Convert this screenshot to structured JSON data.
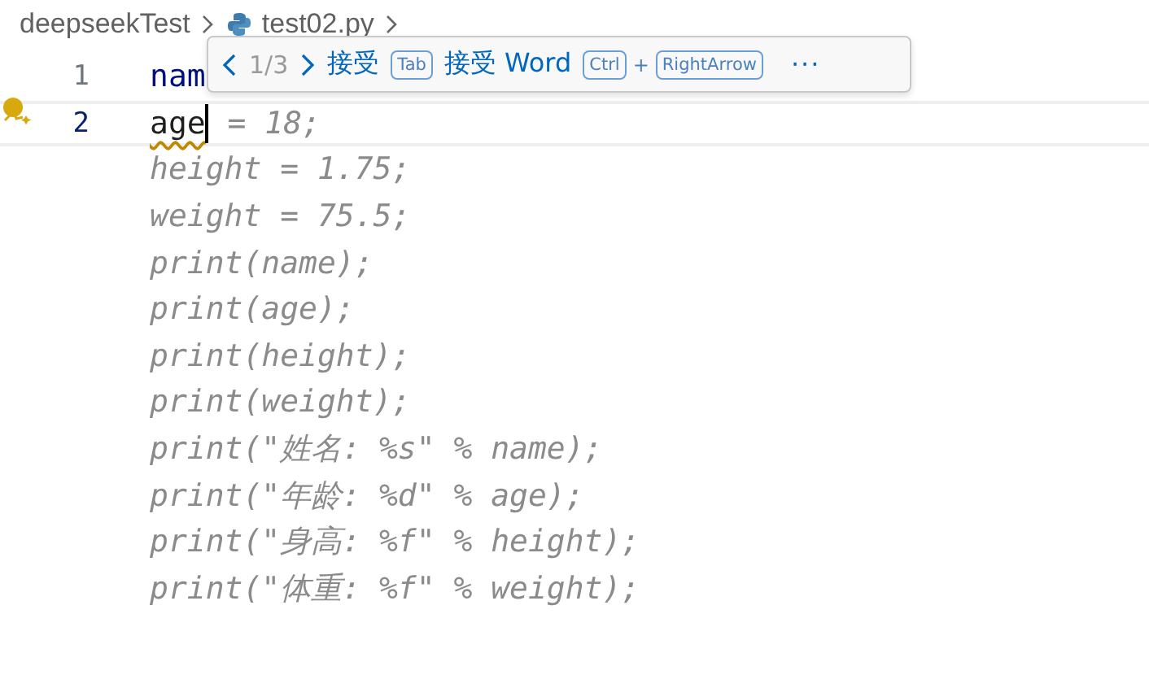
{
  "breadcrumb": [
    {
      "label": "deepseekTest",
      "kind": "folder"
    },
    {
      "label": "test02.py",
      "kind": "python"
    }
  ],
  "lines": [
    {
      "number": "1",
      "text": "nam",
      "current": false,
      "warning": false,
      "lightbulb": false
    },
    {
      "number": "2",
      "text": "age",
      "ghost": " = 18;",
      "current": true,
      "warning": true,
      "lightbulb": true
    }
  ],
  "ghost_lines": [
    "height = 1.75;",
    "weight = 75.5;",
    "print(name);",
    "print(age);",
    "print(height);",
    "print(weight);",
    "print(\"姓名: %s\" % name);",
    "print(\"年龄: %d\" % age);",
    "print(\"身高: %f\" % height);",
    "print(\"体重: %f\" % weight);"
  ],
  "suggestion_widget": {
    "counter": "1/3",
    "items": [
      {
        "kind": "action",
        "label": "接受"
      },
      {
        "kind": "key",
        "label": "Tab"
      },
      {
        "kind": "action",
        "label": "接受 Word"
      },
      {
        "kind": "key",
        "label": "Ctrl"
      },
      {
        "kind": "plus",
        "label": "+"
      },
      {
        "kind": "key",
        "label": "RightArrow"
      }
    ],
    "more": "···"
  }
}
